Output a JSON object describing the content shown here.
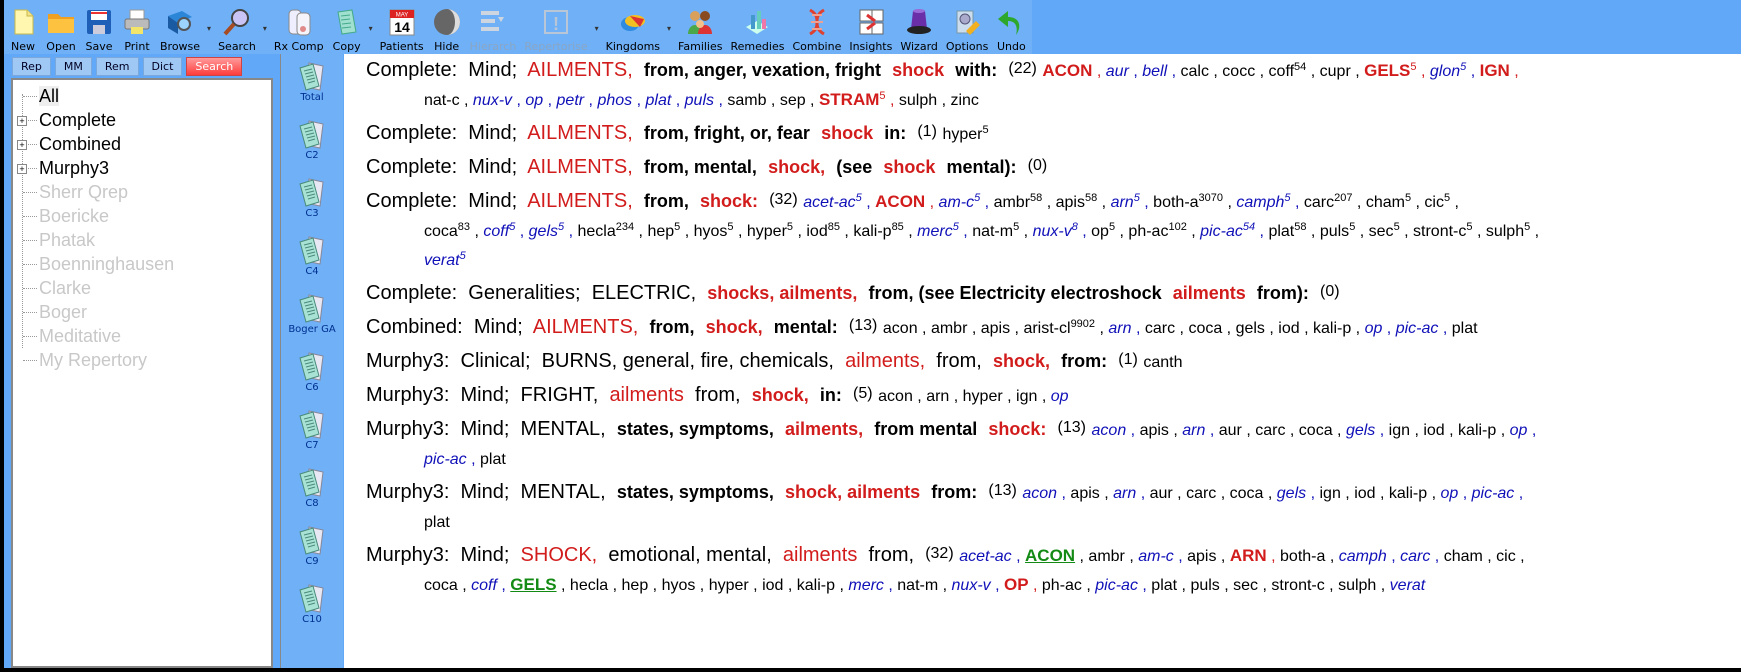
{
  "toolbar": {
    "buttons": [
      {
        "label": "New",
        "icon": "new-document-icon",
        "enabled": true
      },
      {
        "label": "Open",
        "icon": "folder-icon",
        "enabled": true
      },
      {
        "label": "Save",
        "icon": "floppy-disk-icon",
        "enabled": true
      },
      {
        "label": "Print",
        "icon": "printer-icon",
        "enabled": true
      },
      {
        "label": "Browse",
        "icon": "browse-book-icon",
        "enabled": true,
        "dropdown": true
      },
      {
        "label": "Search",
        "icon": "magnifier-icon",
        "enabled": true,
        "dropdown": true
      },
      {
        "label": "Rx Comp",
        "icon": "jars-icon",
        "enabled": true
      },
      {
        "label": "Copy",
        "icon": "copy-pages-icon",
        "enabled": true,
        "dropdown": true
      },
      {
        "label": "Patients",
        "icon": "calendar-icon",
        "enabled": true,
        "calendar_day": "14",
        "calendar_month": "MAY"
      },
      {
        "label": "Hide",
        "icon": "moon-globe-icon",
        "enabled": true
      },
      {
        "label": "Hierarch",
        "icon": "hierarchy-icon",
        "enabled": false
      },
      {
        "label": "Repertorise",
        "icon": "exclamation-icon",
        "enabled": false,
        "dropdown": true
      },
      {
        "label": "Kingdoms",
        "icon": "kingdoms-icon",
        "enabled": true,
        "dropdown": true
      },
      {
        "label": "Families",
        "icon": "families-icon",
        "enabled": true
      },
      {
        "label": "Remedies",
        "icon": "remedies-chart-icon",
        "enabled": true
      },
      {
        "label": "Combine",
        "icon": "dna-icon",
        "enabled": true
      },
      {
        "label": "Insights",
        "icon": "insights-icon",
        "enabled": true
      },
      {
        "label": "Wizard",
        "icon": "wizard-hat-icon",
        "enabled": true
      },
      {
        "label": "Options",
        "icon": "options-icon",
        "enabled": true
      },
      {
        "label": "Undo",
        "icon": "undo-arrow-icon",
        "enabled": true
      }
    ]
  },
  "left_panel": {
    "tabs": [
      {
        "label": "Rep",
        "active": false
      },
      {
        "label": "MM",
        "active": false
      },
      {
        "label": "Rem",
        "active": false
      },
      {
        "label": "Dict",
        "active": false
      },
      {
        "label": "Search",
        "active": true
      }
    ],
    "tree": [
      {
        "label": "All",
        "expandable": false,
        "enabled": true,
        "selected": true
      },
      {
        "label": "Complete",
        "expandable": true,
        "enabled": true
      },
      {
        "label": "Combined",
        "expandable": true,
        "enabled": true
      },
      {
        "label": "Murphy3",
        "expandable": true,
        "enabled": true
      },
      {
        "label": "Sherr Qrep",
        "expandable": false,
        "enabled": false
      },
      {
        "label": "Boericke",
        "expandable": false,
        "enabled": false
      },
      {
        "label": "Phatak",
        "expandable": false,
        "enabled": false
      },
      {
        "label": "Boenninghausen",
        "expandable": false,
        "enabled": false
      },
      {
        "label": "Clarke",
        "expandable": false,
        "enabled": false
      },
      {
        "label": "Boger",
        "expandable": false,
        "enabled": false
      },
      {
        "label": "Meditative",
        "expandable": false,
        "enabled": false
      },
      {
        "label": "My Repertory",
        "expandable": false,
        "enabled": false
      }
    ]
  },
  "shortcuts": [
    "Total",
    "C2",
    "C3",
    "C4",
    "Boger GA",
    "C6",
    "C7",
    "C8",
    "C9",
    "C10"
  ],
  "results": [
    {
      "parts": [
        [
          "src",
          "Complete:"
        ],
        [
          "chap",
          "Mind;"
        ],
        [
          "hl",
          "AILMENTS,"
        ],
        [
          "bold",
          "from, anger, vexation, fright"
        ],
        [
          "hlb",
          "shock"
        ],
        [
          "bold",
          "with:"
        ]
      ],
      "count": "(22)",
      "remedies": [
        [
          "ACON",
          3,
          ""
        ],
        [
          "aur",
          2,
          ""
        ],
        [
          "bell",
          2,
          ""
        ],
        [
          "calc",
          1,
          ""
        ],
        [
          "cocc",
          1,
          ""
        ],
        [
          "coff",
          1,
          "54"
        ],
        [
          "cupr",
          1,
          ""
        ],
        [
          "GELS",
          3,
          "5"
        ],
        [
          "glon",
          2,
          "5"
        ],
        [
          "IGN",
          3,
          ""
        ],
        [
          "nat-c",
          1,
          ""
        ],
        [
          "nux-v",
          2,
          ""
        ],
        [
          "op",
          2,
          ""
        ],
        [
          "petr",
          2,
          ""
        ],
        [
          "phos",
          2,
          ""
        ],
        [
          "plat",
          2,
          ""
        ],
        [
          "puls",
          2,
          ""
        ],
        [
          "samb",
          1,
          ""
        ],
        [
          "sep",
          1,
          ""
        ],
        [
          "STRAM",
          3,
          "5"
        ],
        [
          "sulph",
          1,
          ""
        ],
        [
          "zinc",
          1,
          ""
        ]
      ],
      "break_after": 10
    },
    {
      "parts": [
        [
          "src",
          "Complete:"
        ],
        [
          "chap",
          "Mind;"
        ],
        [
          "hl",
          "AILMENTS,"
        ],
        [
          "bold",
          "from, fright, or, fear"
        ],
        [
          "hlb",
          "shock"
        ],
        [
          "bold",
          "in:"
        ]
      ],
      "count": "(1)",
      "remedies": [
        [
          "hyper",
          1,
          "5"
        ]
      ]
    },
    {
      "parts": [
        [
          "src",
          "Complete:"
        ],
        [
          "chap",
          "Mind;"
        ],
        [
          "hl",
          "AILMENTS,"
        ],
        [
          "bold",
          "from, mental,"
        ],
        [
          "hlb",
          "shock,"
        ],
        [
          "bold",
          "(see"
        ],
        [
          "hlb",
          "shock"
        ],
        [
          "bold",
          "mental):"
        ]
      ],
      "count": "(0)",
      "remedies": []
    },
    {
      "parts": [
        [
          "src",
          "Complete:"
        ],
        [
          "chap",
          "Mind;"
        ],
        [
          "hl",
          "AILMENTS,"
        ],
        [
          "bold",
          "from,"
        ],
        [
          "hlb",
          "shock:"
        ]
      ],
      "count": "(32)",
      "remedies": [
        [
          "acet-ac",
          2,
          "5"
        ],
        [
          "ACON",
          3,
          ""
        ],
        [
          "am-c",
          2,
          "5"
        ],
        [
          "ambr",
          1,
          "58"
        ],
        [
          "apis",
          1,
          "58"
        ],
        [
          "arn",
          2,
          "5"
        ],
        [
          "both-a",
          1,
          "3070"
        ],
        [
          "camph",
          2,
          "5"
        ],
        [
          "carc",
          1,
          "207"
        ],
        [
          "cham",
          1,
          "5"
        ],
        [
          "cic",
          1,
          "5"
        ],
        [
          "coca",
          1,
          "83"
        ],
        [
          "coff",
          2,
          "5"
        ],
        [
          "gels",
          2,
          "5"
        ],
        [
          "hecla",
          1,
          "234"
        ],
        [
          "hep",
          1,
          "5"
        ],
        [
          "hyos",
          1,
          "5"
        ],
        [
          "hyper",
          1,
          "5"
        ],
        [
          "iod",
          1,
          "85"
        ],
        [
          "kali-p",
          1,
          "85"
        ],
        [
          "merc",
          2,
          "5"
        ],
        [
          "nat-m",
          1,
          "5"
        ],
        [
          "nux-v",
          2,
          "8"
        ],
        [
          "op",
          1,
          "5"
        ],
        [
          "ph-ac",
          1,
          "102"
        ],
        [
          "pic-ac",
          2,
          "54"
        ],
        [
          "plat",
          1,
          "58"
        ],
        [
          "puls",
          1,
          "5"
        ],
        [
          "sec",
          1,
          "5"
        ],
        [
          "stront-c",
          1,
          "5"
        ],
        [
          "sulph",
          1,
          "5"
        ],
        [
          "verat",
          2,
          "5"
        ]
      ],
      "break_after": 11,
      "break_after2": 31
    },
    {
      "parts": [
        [
          "src",
          "Complete:"
        ],
        [
          "chap",
          "Generalities;"
        ],
        [
          "plain",
          "ELECTRIC,"
        ],
        [
          "hlb",
          "shocks, ailments,"
        ],
        [
          "bold",
          "from, (see Electricity electroshock"
        ],
        [
          "hlb",
          "ailments"
        ],
        [
          "bold",
          "from):"
        ]
      ],
      "count": "(0)",
      "remedies": []
    },
    {
      "parts": [
        [
          "src",
          "Combined:"
        ],
        [
          "chap",
          "Mind;"
        ],
        [
          "hl",
          "AILMENTS,"
        ],
        [
          "bold",
          "from,"
        ],
        [
          "hlb",
          "shock,"
        ],
        [
          "bold",
          "mental:"
        ]
      ],
      "count": "(13)",
      "remedies": [
        [
          "acon",
          1,
          ""
        ],
        [
          "ambr",
          1,
          ""
        ],
        [
          "apis",
          1,
          ""
        ],
        [
          "arist-cl",
          1,
          "9902"
        ],
        [
          "arn",
          2,
          ""
        ],
        [
          "carc",
          1,
          ""
        ],
        [
          "coca",
          1,
          ""
        ],
        [
          "gels",
          1,
          ""
        ],
        [
          "iod",
          1,
          ""
        ],
        [
          "kali-p",
          1,
          ""
        ],
        [
          "op",
          2,
          ""
        ],
        [
          "pic-ac",
          2,
          ""
        ],
        [
          "plat",
          1,
          ""
        ]
      ]
    },
    {
      "parts": [
        [
          "src",
          "Murphy3:"
        ],
        [
          "chap",
          "Clinical;"
        ],
        [
          "plain",
          "BURNS, general, fire, chemicals,"
        ],
        [
          "hl",
          "ailments,"
        ],
        [
          "plain",
          "from,"
        ],
        [
          "hlb",
          "shock,"
        ],
        [
          "bold",
          "from:"
        ]
      ],
      "count": "(1)",
      "remedies": [
        [
          "canth",
          1,
          ""
        ]
      ]
    },
    {
      "parts": [
        [
          "src",
          "Murphy3:"
        ],
        [
          "chap",
          "Mind;"
        ],
        [
          "plain",
          "FRIGHT,"
        ],
        [
          "hl",
          "ailments"
        ],
        [
          "plain",
          "from,"
        ],
        [
          "hlb",
          "shock,"
        ],
        [
          "bold",
          "in:"
        ]
      ],
      "count": "(5)",
      "remedies": [
        [
          "acon",
          1,
          ""
        ],
        [
          "arn",
          1,
          ""
        ],
        [
          "hyper",
          1,
          ""
        ],
        [
          "ign",
          1,
          ""
        ],
        [
          "op",
          2,
          ""
        ]
      ]
    },
    {
      "parts": [
        [
          "src",
          "Murphy3:"
        ],
        [
          "chap",
          "Mind;"
        ],
        [
          "plain",
          "MENTAL,"
        ],
        [
          "bold",
          "states, symptoms,"
        ],
        [
          "hlb",
          "ailments,"
        ],
        [
          "bold",
          "from mental"
        ],
        [
          "hlb",
          "shock:"
        ]
      ],
      "count": "(13)",
      "remedies": [
        [
          "acon",
          2,
          ""
        ],
        [
          "apis",
          1,
          ""
        ],
        [
          "arn",
          2,
          ""
        ],
        [
          "aur",
          1,
          ""
        ],
        [
          "carc",
          1,
          ""
        ],
        [
          "coca",
          1,
          ""
        ],
        [
          "gels",
          2,
          ""
        ],
        [
          "ign",
          1,
          ""
        ],
        [
          "iod",
          1,
          ""
        ],
        [
          "kali-p",
          1,
          ""
        ],
        [
          "op",
          2,
          ""
        ],
        [
          "pic-ac",
          2,
          ""
        ],
        [
          "plat",
          1,
          ""
        ]
      ],
      "break_after": 11
    },
    {
      "parts": [
        [
          "src",
          "Murphy3:"
        ],
        [
          "chap",
          "Mind;"
        ],
        [
          "plain",
          "MENTAL,"
        ],
        [
          "bold",
          "states, symptoms,"
        ],
        [
          "hlb",
          "shock, ailments"
        ],
        [
          "bold",
          "from:"
        ]
      ],
      "count": "(13)",
      "remedies": [
        [
          "acon",
          2,
          ""
        ],
        [
          "apis",
          1,
          ""
        ],
        [
          "arn",
          2,
          ""
        ],
        [
          "aur",
          1,
          ""
        ],
        [
          "carc",
          1,
          ""
        ],
        [
          "coca",
          1,
          ""
        ],
        [
          "gels",
          2,
          ""
        ],
        [
          "ign",
          1,
          ""
        ],
        [
          "iod",
          1,
          ""
        ],
        [
          "kali-p",
          1,
          ""
        ],
        [
          "op",
          2,
          ""
        ],
        [
          "pic-ac",
          2,
          ""
        ],
        [
          "plat",
          1,
          ""
        ]
      ],
      "break_after": 12
    },
    {
      "parts": [
        [
          "src",
          "Murphy3:"
        ],
        [
          "chap",
          "Mind;"
        ],
        [
          "hl",
          "SHOCK,"
        ],
        [
          "plain",
          "emotional, mental,"
        ],
        [
          "hl",
          "ailments"
        ],
        [
          "plain",
          "from,"
        ]
      ],
      "count": "(32)",
      "remedies": [
        [
          "acet-ac",
          2,
          ""
        ],
        [
          "ACON",
          4,
          ""
        ],
        [
          "ambr",
          1,
          ""
        ],
        [
          "am-c",
          2,
          ""
        ],
        [
          "apis",
          1,
          ""
        ],
        [
          "ARN",
          3,
          ""
        ],
        [
          "both-a",
          1,
          ""
        ],
        [
          "camph",
          2,
          ""
        ],
        [
          "carc",
          2,
          ""
        ],
        [
          "cham",
          1,
          ""
        ],
        [
          "cic",
          1,
          ""
        ],
        [
          "coca",
          1,
          ""
        ],
        [
          "coff",
          2,
          ""
        ],
        [
          "GELS",
          4,
          ""
        ],
        [
          "hecla",
          1,
          ""
        ],
        [
          "hep",
          1,
          ""
        ],
        [
          "hyos",
          1,
          ""
        ],
        [
          "hyper",
          1,
          ""
        ],
        [
          "iod",
          1,
          ""
        ],
        [
          "kali-p",
          1,
          ""
        ],
        [
          "merc",
          2,
          ""
        ],
        [
          "nat-m",
          1,
          ""
        ],
        [
          "nux-v",
          2,
          ""
        ],
        [
          "OP",
          3,
          ""
        ],
        [
          "ph-ac",
          1,
          ""
        ],
        [
          "pic-ac",
          2,
          ""
        ],
        [
          "plat",
          1,
          ""
        ],
        [
          "puls",
          1,
          ""
        ],
        [
          "sec",
          1,
          ""
        ],
        [
          "stront-c",
          1,
          ""
        ],
        [
          "sulph",
          1,
          ""
        ],
        [
          "verat",
          2,
          ""
        ]
      ],
      "break_after": 11
    }
  ],
  "colors": {
    "toolbar_bg": "#62a8f8",
    "highlight_red": "#d21c1c",
    "italic_blue": "#1010b8",
    "grade4_green": "#138a13",
    "disabled_gray": "#c8c8c8"
  }
}
